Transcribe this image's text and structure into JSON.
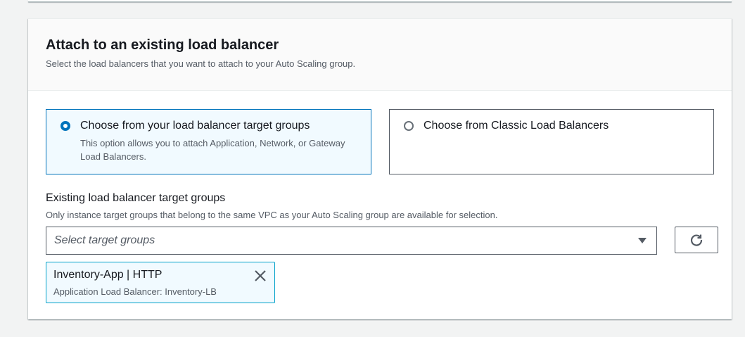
{
  "section": {
    "title": "Attach to an existing load balancer",
    "description": "Select the load balancers that you want to attach to your Auto Scaling group."
  },
  "options": [
    {
      "label": "Choose from your load balancer target groups",
      "description": "This option allows you to attach Application, Network, or Gateway Load Balancers.",
      "selected": true
    },
    {
      "label": "Choose from Classic Load Balancers",
      "description": "",
      "selected": false
    }
  ],
  "target_groups": {
    "label": "Existing load balancer target groups",
    "description": "Only instance target groups that belong to the same VPC as your Auto Scaling group are available for selection.",
    "placeholder": "Select target groups",
    "tokens": [
      {
        "title": "Inventory-App | HTTP",
        "subtitle": "Application Load Balancer: Inventory-LB"
      }
    ]
  },
  "icons": {
    "dropdown": "caret-down-icon",
    "refresh": "refresh-icon",
    "remove": "close-icon"
  },
  "colors": {
    "accent": "#0073bb",
    "selected_bg": "#f1faff",
    "token_border": "#00a1c9"
  }
}
